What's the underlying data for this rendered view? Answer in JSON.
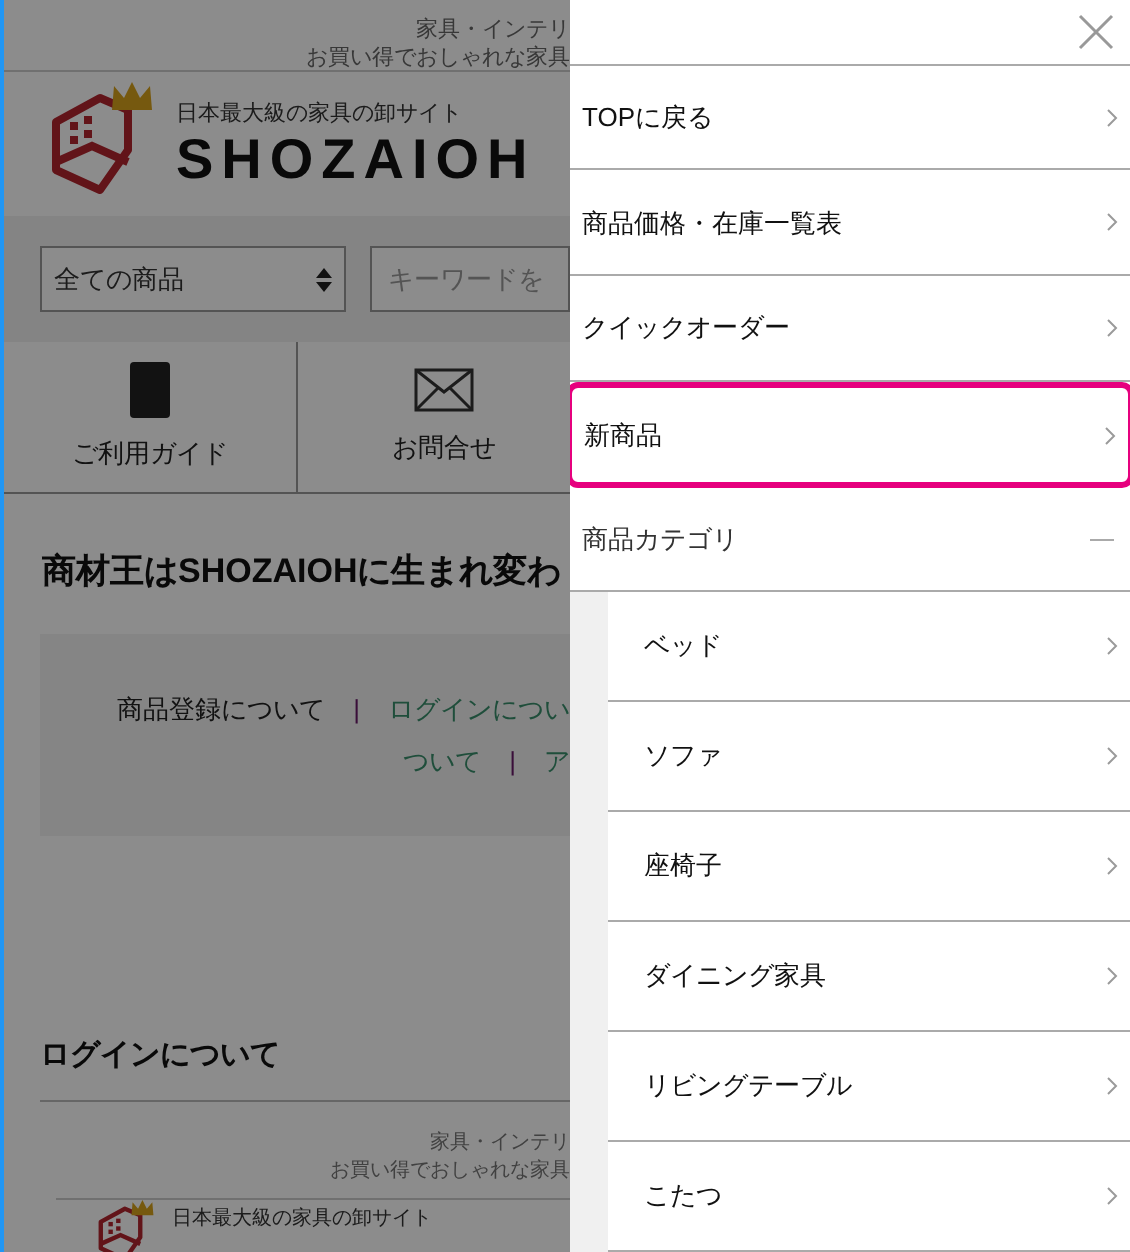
{
  "page": {
    "top_notice": [
      "家具・インテリ",
      "お買い得でおしゃれな家具"
    ],
    "logo": {
      "subtitle": "日本最大級の家具の卸サイト",
      "name": "SHOZAIOH"
    },
    "category_select": {
      "value": "全ての商品"
    },
    "search": {
      "placeholder": "キーワードを"
    },
    "nav": [
      {
        "label": "ご利用ガイド",
        "kind": "book"
      },
      {
        "label": "お問合せ",
        "kind": "mail"
      }
    ],
    "headline": "商材王はSHOZAIOHに生まれ変わ",
    "link_lines": [
      [
        {
          "kind": "link",
          "label": "商品登録について",
          "visited": true
        },
        {
          "kind": "separator",
          "label": "|"
        },
        {
          "kind": "link",
          "label": "ログインについ",
          "visited": false
        }
      ],
      [
        {
          "kind": "link",
          "label": "ついて",
          "visited": false
        },
        {
          "kind": "separator",
          "label": "|"
        },
        {
          "kind": "link",
          "label": "ア",
          "visited": false
        }
      ]
    ],
    "section_title": "ログインについて",
    "footer": {
      "notice": [
        "家具・インテリ",
        "お買い得でおしゃれな家具"
      ],
      "logo_subtitle": "日本最大級の家具の卸サイト"
    }
  },
  "drawer": {
    "items": [
      {
        "label": "TOPに戻る",
        "highlighted": false
      },
      {
        "label": "商品価格・在庫一覧表",
        "highlighted": false
      },
      {
        "label": "クイックオーダー",
        "highlighted": false
      },
      {
        "label": "新商品",
        "highlighted": true
      }
    ],
    "category": {
      "label": "商品カテゴリ",
      "expanded": true,
      "children": [
        {
          "label": "ベッド"
        },
        {
          "label": "ソファ"
        },
        {
          "label": "座椅子"
        },
        {
          "label": "ダイニング家具"
        },
        {
          "label": "リビングテーブル"
        },
        {
          "label": "こたつ"
        }
      ]
    }
  }
}
